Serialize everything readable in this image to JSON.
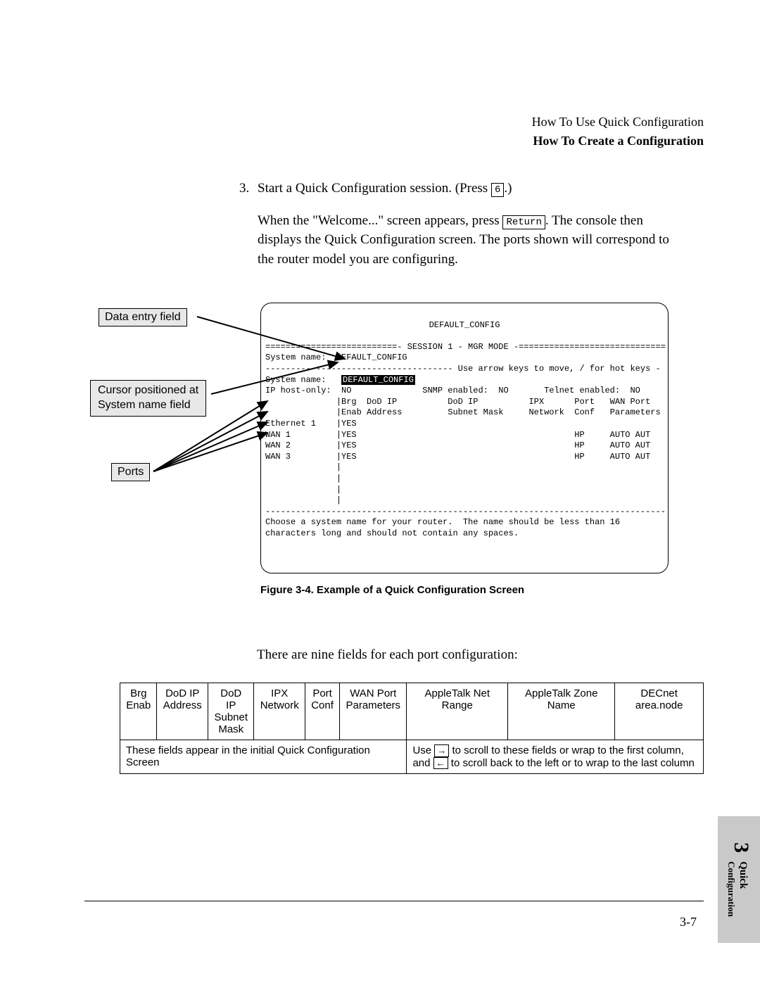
{
  "header": {
    "line1": "How To Use Quick Configuration",
    "line2": "How To Create a Configuration"
  },
  "step3": {
    "num": "3.",
    "text_pre": "Start a Quick Configuration session. (Press ",
    "key": "6",
    "text_post": ".)"
  },
  "para1_pre": "When the \"Welcome...\" screen appears, press ",
  "para1_key": "Return",
  "para1_post": ". The console then displays the Quick Configuration screen. The ports shown will correspond to the router model you are configuring.",
  "callouts": {
    "entry": "Data entry field",
    "cursor_l1": "Cursor positioned at",
    "cursor_l2": "System name field",
    "ports": "Ports"
  },
  "terminal": {
    "title": "DEFAULT_CONFIG",
    "session": "==========================- SESSION 1 - MGR MODE -=============================",
    "sysline": "System name:  DEFAULT_CONFIG",
    "hint": "------------------------------------- Use arrow keys to move, / for hot keys -",
    "f_sys": "System name:   ",
    "f_sys_val": "DEFAULT_CONFIG",
    "f_ip": "IP host-only:  NO              SNMP enabled:  NO       Telnet enabled:  NO",
    "hdr1": "              |Brg  DoD IP          DoD IP          IPX      Port   WAN Port",
    "hdr2": "              |Enab Address         Subnet Mask     Network  Conf   Parameters",
    "row_e": "Ethernet 1    |YES",
    "row_w1": "WAN 1         |YES                                           HP     AUTO AUT",
    "row_w2": "WAN 2         |YES                                           HP     AUTO AUT",
    "row_w3": "WAN 3         |YES                                           HP     AUTO AUT",
    "sep": "-------------------------------------------------------------------------------",
    "help1": "Choose a system name for your router.  The name should be less than 16",
    "help2": "characters long and should not contain any spaces."
  },
  "figure_caption": "Figure  3-4.  Example of a Quick Configuration Screen",
  "fields_intro": "There are nine fields for each port configuration:",
  "table": {
    "h1": "Brg\nEnab",
    "h2": "DoD IP\nAddress",
    "h3": "DoD IP\nSubnet\nMask",
    "h4": "IPX\nNetwork",
    "h5": "Port\nConf",
    "h6": "WAN Port\nParameters",
    "h7": "AppleTalk Net\nRange",
    "h8": "AppleTalk Zone\nName",
    "h9": "DECnet\narea.node",
    "note_left": "These fields appear in the initial Quick Configuration Screen",
    "note_right_1": "Use ",
    "note_right_arrow_r": "→",
    "note_right_2": " to scroll to these fields or wrap to the first column, and ",
    "note_right_arrow_l": "←",
    "note_right_3": " to scroll back to the left or to wrap to the last column"
  },
  "sidetab": {
    "num": "3",
    "line1": "Quick",
    "line2": "Configuration"
  },
  "page_number": "3-7"
}
